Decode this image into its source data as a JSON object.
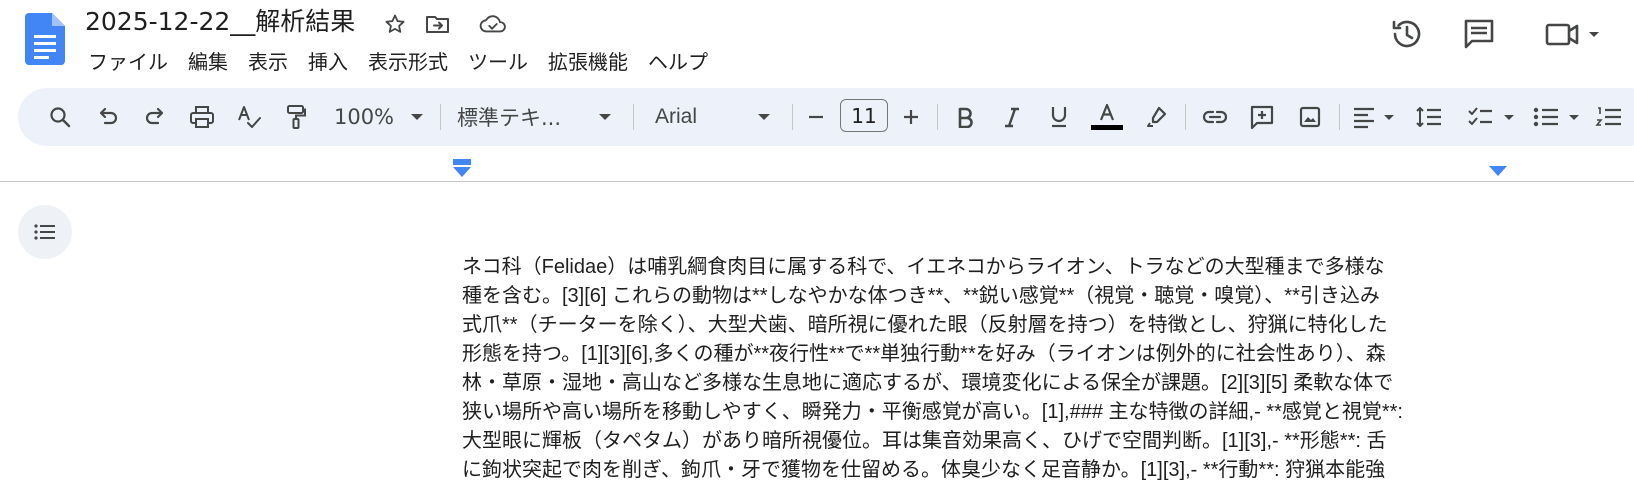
{
  "document": {
    "title": "2025-12-22__解析結果"
  },
  "menu": [
    {
      "label": "ファイル"
    },
    {
      "label": "編集"
    },
    {
      "label": "表示"
    },
    {
      "label": "挿入"
    },
    {
      "label": "表示形式"
    },
    {
      "label": "ツール"
    },
    {
      "label": "拡張機能"
    },
    {
      "label": "ヘルプ"
    }
  ],
  "toolbar": {
    "zoom": "100%",
    "style": "標準テキ...",
    "font": "Arial",
    "font_size": "11",
    "text_color": "#000000"
  },
  "colors": {
    "accent": "#1a73e8",
    "toolbar_bg": "#edf2fa",
    "ruler_marker": "#4285f4"
  },
  "icons": [
    "docs-logo-icon",
    "star-icon",
    "move-folder-icon",
    "cloud-saved-icon",
    "version-history-icon",
    "comments-icon",
    "meet-icon",
    "search-icon",
    "undo-icon",
    "redo-icon",
    "print-icon",
    "spellcheck-icon",
    "paint-format-icon",
    "decrease-font-icon",
    "increase-font-icon",
    "bold-icon",
    "italic-icon",
    "underline-icon",
    "text-color-icon",
    "highlight-icon",
    "link-icon",
    "add-comment-icon",
    "insert-image-icon",
    "align-icon",
    "line-spacing-icon",
    "checklist-icon",
    "bulleted-list-icon",
    "numbered-list-icon",
    "outline-icon"
  ],
  "body": {
    "lines": [
      "ネコ科（Felidae）は哺乳綱食肉目に属する科で、イエネコからライオン、トラなどの大型種まで多様な",
      "種を含む。[3][6] これらの動物は**しなやかな体つき**、**鋭い感覚**（視覚・聴覚・嗅覚）、**引き込み",
      "式爪**（チーターを除く）、大型犬歯、暗所視に優れた眼（反射層を持つ）を特徴とし、狩猟に特化した",
      "形態を持つ。[1][3][6],多くの種が**夜行性**で**単独行動**を好み（ライオンは例外的に社会性あり）、森",
      "林・草原・湿地・高山など多様な生息地に適応するが、環境変化による保全が課題。[2][3][5] 柔軟な体で",
      "狭い場所や高い場所を移動しやすく、瞬発力・平衡感覚が高い。[1],### 主な特徴の詳細,- **感覚と視覚**:",
      "大型眼に輝板（タペタム）があり暗所視優位。耳は集音効果高く、ひげで空間判断。[1][3],- **形態**: 舌",
      "に鉤状突起で肉を削ぎ、鉤爪・牙で獲物を仕留める。体臭少なく足音静か。[1][3],- **行動**: 狩猟本能強"
    ]
  }
}
